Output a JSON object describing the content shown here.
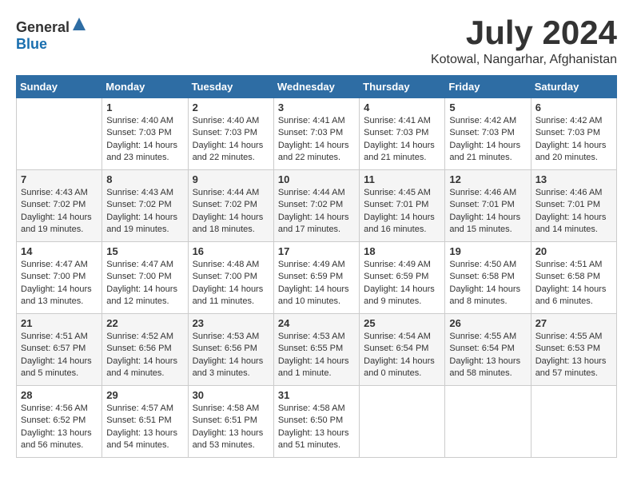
{
  "header": {
    "logo_general": "General",
    "logo_blue": "Blue",
    "month": "July 2024",
    "location": "Kotowal, Nangarhar, Afghanistan"
  },
  "days_of_week": [
    "Sunday",
    "Monday",
    "Tuesday",
    "Wednesday",
    "Thursday",
    "Friday",
    "Saturday"
  ],
  "weeks": [
    [
      {
        "day": "",
        "info": ""
      },
      {
        "day": "1",
        "info": "Sunrise: 4:40 AM\nSunset: 7:03 PM\nDaylight: 14 hours\nand 23 minutes."
      },
      {
        "day": "2",
        "info": "Sunrise: 4:40 AM\nSunset: 7:03 PM\nDaylight: 14 hours\nand 22 minutes."
      },
      {
        "day": "3",
        "info": "Sunrise: 4:41 AM\nSunset: 7:03 PM\nDaylight: 14 hours\nand 22 minutes."
      },
      {
        "day": "4",
        "info": "Sunrise: 4:41 AM\nSunset: 7:03 PM\nDaylight: 14 hours\nand 21 minutes."
      },
      {
        "day": "5",
        "info": "Sunrise: 4:42 AM\nSunset: 7:03 PM\nDaylight: 14 hours\nand 21 minutes."
      },
      {
        "day": "6",
        "info": "Sunrise: 4:42 AM\nSunset: 7:03 PM\nDaylight: 14 hours\nand 20 minutes."
      }
    ],
    [
      {
        "day": "7",
        "info": "Sunrise: 4:43 AM\nSunset: 7:02 PM\nDaylight: 14 hours\nand 19 minutes."
      },
      {
        "day": "8",
        "info": "Sunrise: 4:43 AM\nSunset: 7:02 PM\nDaylight: 14 hours\nand 19 minutes."
      },
      {
        "day": "9",
        "info": "Sunrise: 4:44 AM\nSunset: 7:02 PM\nDaylight: 14 hours\nand 18 minutes."
      },
      {
        "day": "10",
        "info": "Sunrise: 4:44 AM\nSunset: 7:02 PM\nDaylight: 14 hours\nand 17 minutes."
      },
      {
        "day": "11",
        "info": "Sunrise: 4:45 AM\nSunset: 7:01 PM\nDaylight: 14 hours\nand 16 minutes."
      },
      {
        "day": "12",
        "info": "Sunrise: 4:46 AM\nSunset: 7:01 PM\nDaylight: 14 hours\nand 15 minutes."
      },
      {
        "day": "13",
        "info": "Sunrise: 4:46 AM\nSunset: 7:01 PM\nDaylight: 14 hours\nand 14 minutes."
      }
    ],
    [
      {
        "day": "14",
        "info": "Sunrise: 4:47 AM\nSunset: 7:00 PM\nDaylight: 14 hours\nand 13 minutes."
      },
      {
        "day": "15",
        "info": "Sunrise: 4:47 AM\nSunset: 7:00 PM\nDaylight: 14 hours\nand 12 minutes."
      },
      {
        "day": "16",
        "info": "Sunrise: 4:48 AM\nSunset: 7:00 PM\nDaylight: 14 hours\nand 11 minutes."
      },
      {
        "day": "17",
        "info": "Sunrise: 4:49 AM\nSunset: 6:59 PM\nDaylight: 14 hours\nand 10 minutes."
      },
      {
        "day": "18",
        "info": "Sunrise: 4:49 AM\nSunset: 6:59 PM\nDaylight: 14 hours\nand 9 minutes."
      },
      {
        "day": "19",
        "info": "Sunrise: 4:50 AM\nSunset: 6:58 PM\nDaylight: 14 hours\nand 8 minutes."
      },
      {
        "day": "20",
        "info": "Sunrise: 4:51 AM\nSunset: 6:58 PM\nDaylight: 14 hours\nand 6 minutes."
      }
    ],
    [
      {
        "day": "21",
        "info": "Sunrise: 4:51 AM\nSunset: 6:57 PM\nDaylight: 14 hours\nand 5 minutes."
      },
      {
        "day": "22",
        "info": "Sunrise: 4:52 AM\nSunset: 6:56 PM\nDaylight: 14 hours\nand 4 minutes."
      },
      {
        "day": "23",
        "info": "Sunrise: 4:53 AM\nSunset: 6:56 PM\nDaylight: 14 hours\nand 3 minutes."
      },
      {
        "day": "24",
        "info": "Sunrise: 4:53 AM\nSunset: 6:55 PM\nDaylight: 14 hours\nand 1 minute."
      },
      {
        "day": "25",
        "info": "Sunrise: 4:54 AM\nSunset: 6:54 PM\nDaylight: 14 hours\nand 0 minutes."
      },
      {
        "day": "26",
        "info": "Sunrise: 4:55 AM\nSunset: 6:54 PM\nDaylight: 13 hours\nand 58 minutes."
      },
      {
        "day": "27",
        "info": "Sunrise: 4:55 AM\nSunset: 6:53 PM\nDaylight: 13 hours\nand 57 minutes."
      }
    ],
    [
      {
        "day": "28",
        "info": "Sunrise: 4:56 AM\nSunset: 6:52 PM\nDaylight: 13 hours\nand 56 minutes."
      },
      {
        "day": "29",
        "info": "Sunrise: 4:57 AM\nSunset: 6:51 PM\nDaylight: 13 hours\nand 54 minutes."
      },
      {
        "day": "30",
        "info": "Sunrise: 4:58 AM\nSunset: 6:51 PM\nDaylight: 13 hours\nand 53 minutes."
      },
      {
        "day": "31",
        "info": "Sunrise: 4:58 AM\nSunset: 6:50 PM\nDaylight: 13 hours\nand 51 minutes."
      },
      {
        "day": "",
        "info": ""
      },
      {
        "day": "",
        "info": ""
      },
      {
        "day": "",
        "info": ""
      }
    ]
  ]
}
